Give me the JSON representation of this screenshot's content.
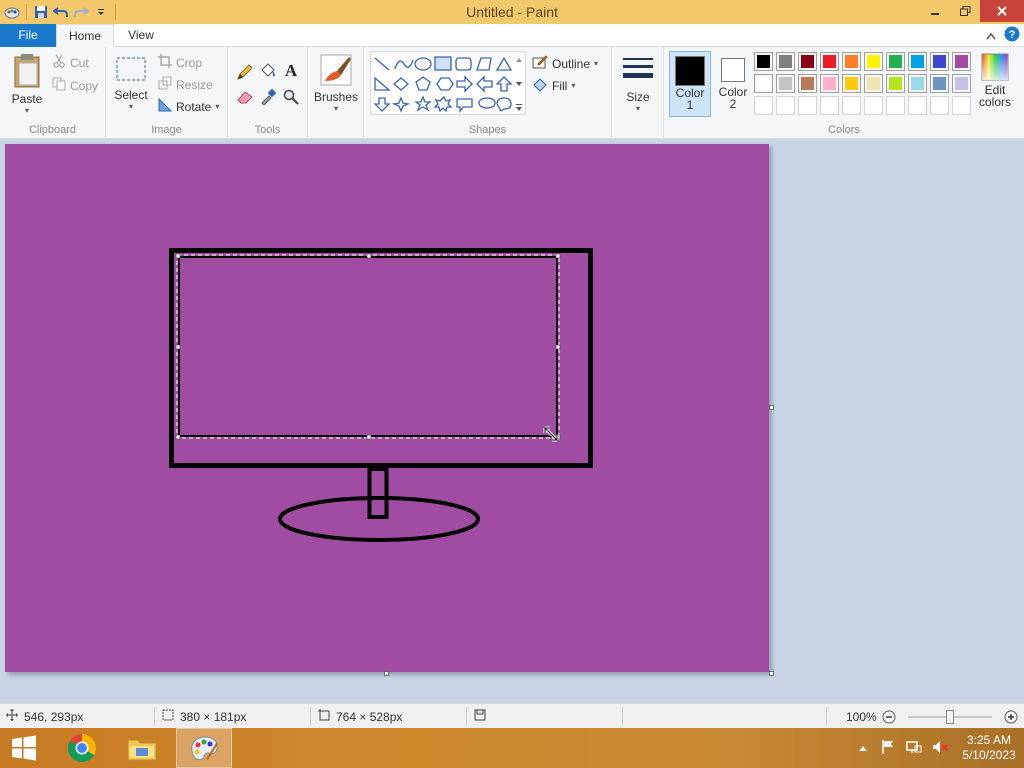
{
  "window": {
    "title": "Untitled - Paint"
  },
  "tabs": {
    "file": "File",
    "home": "Home",
    "view": "View"
  },
  "ribbon": {
    "clipboard": {
      "label": "Clipboard",
      "paste": "Paste",
      "cut": "Cut",
      "copy": "Copy"
    },
    "image": {
      "label": "Image",
      "select": "Select",
      "crop": "Crop",
      "resize": "Resize",
      "rotate": "Rotate"
    },
    "tools": {
      "label": "Tools"
    },
    "brushes": {
      "label": "Brushes"
    },
    "shapes": {
      "label": "Shapes",
      "outline": "Outline",
      "fill": "Fill"
    },
    "size": {
      "label": "Size"
    },
    "colors": {
      "label": "Colors",
      "color1_line1": "Color",
      "color1_line2": "1",
      "color2_line1": "Color",
      "color2_line2": "2",
      "edit_line1": "Edit",
      "edit_line2": "colors",
      "color1_value": "#000000",
      "color2_value": "#ffffff",
      "row1": [
        "#000000",
        "#7f7f7f",
        "#880015",
        "#ed1c24",
        "#ff7f27",
        "#fff200",
        "#22b14c",
        "#00a2e8",
        "#3f48cc",
        "#a349a4"
      ],
      "row2": [
        "#ffffff",
        "#c3c3c3",
        "#b97a57",
        "#ffaec9",
        "#ffc90e",
        "#efe4b0",
        "#b5e61d",
        "#99d9ea",
        "#7092be",
        "#c8bfe7"
      ]
    }
  },
  "canvas": {
    "background": "#a04ca2"
  },
  "status": {
    "cursor_pos": "546, 293px",
    "selection_size": "380 × 181px",
    "image_size": "764 × 528px",
    "zoom": "100%"
  },
  "taskbar": {
    "time": "3:25 AM",
    "date": "5/10/2023"
  }
}
